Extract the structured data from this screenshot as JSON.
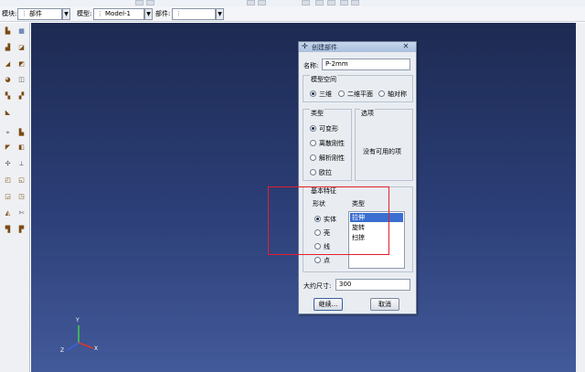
{
  "context": {
    "module_label": "模块:",
    "module_value": "部件",
    "model_label": "模型:",
    "model_value": "Model-1",
    "part_label": "部件:",
    "part_value": ""
  },
  "dialog": {
    "title": "创建部件",
    "close_glyph": "✕",
    "name_label": "名称:",
    "name_value": "P-2mm",
    "modeling_space_label": "模型空间",
    "space_options": [
      "三维",
      "二维平面",
      "轴对称"
    ],
    "space_selected": "三维",
    "type_group_label": "类型",
    "type_options": [
      "可变形",
      "离散刚性",
      "解析刚性",
      "欧拉"
    ],
    "type_selected": "可变形",
    "options_group_label": "选项",
    "options_text": "没有可用的项",
    "base_feature_label": "基本特征",
    "shape_label": "形状",
    "shape_options": [
      "实体",
      "壳",
      "线",
      "点"
    ],
    "shape_selected": "实体",
    "feature_type_label": "类型",
    "feature_type_options": [
      "拉伸",
      "旋转",
      "扫掠"
    ],
    "feature_type_selected": "拉伸",
    "approx_size_label": "大约尺寸:",
    "approx_size_value": "300",
    "continue_button": "继续...",
    "cancel_button": "取消"
  },
  "triad": {
    "y": "Y",
    "x": "X",
    "z": "Z"
  },
  "colors": {
    "highlight": "#e2202c",
    "selection": "#3a6fd1",
    "viewport_top": "#1d2a52",
    "viewport_bottom": "#435a9a"
  },
  "toolbox_icons": [
    "create-part-icon",
    "part-manager-icon",
    "create-solid-extrude-icon",
    "create-shell-icon",
    "create-wire-icon",
    "create-cut-icon",
    "create-round-icon",
    "datum-point-icon",
    "datum-axis-icon",
    "datum-plane-icon",
    "partition-icon",
    "virtual-topology-icon",
    "repair-icon",
    "query-icon"
  ]
}
